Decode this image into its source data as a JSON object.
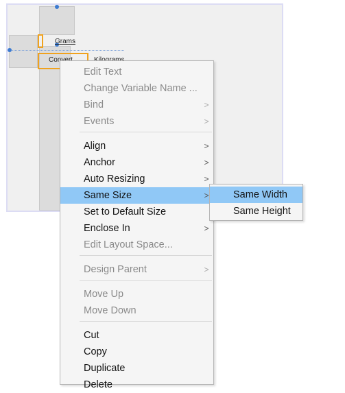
{
  "canvas": {
    "components": [
      {
        "name": "grams-label",
        "text": "Grams"
      },
      {
        "name": "convert-button",
        "text": "Convert"
      },
      {
        "name": "kilograms-label",
        "text": "Kilograms"
      }
    ]
  },
  "context_menu": {
    "items": [
      {
        "label": "Edit Text",
        "enabled": false,
        "submenu": false
      },
      {
        "label": "Change Variable Name ...",
        "enabled": false,
        "submenu": false
      },
      {
        "label": "Bind",
        "enabled": false,
        "submenu": true
      },
      {
        "label": "Events",
        "enabled": false,
        "submenu": true
      },
      {
        "label": "Align",
        "enabled": true,
        "submenu": true
      },
      {
        "label": "Anchor",
        "enabled": true,
        "submenu": true
      },
      {
        "label": "Auto Resizing",
        "enabled": true,
        "submenu": true
      },
      {
        "label": "Same Size",
        "enabled": true,
        "submenu": true,
        "highlighted": true
      },
      {
        "label": "Set to Default Size",
        "enabled": true,
        "submenu": false
      },
      {
        "label": "Enclose In",
        "enabled": true,
        "submenu": true
      },
      {
        "label": "Edit Layout Space...",
        "enabled": false,
        "submenu": false
      },
      {
        "label": "Design Parent",
        "enabled": false,
        "submenu": true
      },
      {
        "label": "Move Up",
        "enabled": false,
        "submenu": false
      },
      {
        "label": "Move Down",
        "enabled": false,
        "submenu": false
      },
      {
        "label": "Cut",
        "enabled": true,
        "submenu": false
      },
      {
        "label": "Copy",
        "enabled": true,
        "submenu": false
      },
      {
        "label": "Duplicate",
        "enabled": true,
        "submenu": false
      },
      {
        "label": "Delete",
        "enabled": true,
        "submenu": false
      }
    ],
    "submenu_chevron": ">"
  },
  "same_size_submenu": {
    "items": [
      {
        "label": "Same Width",
        "highlighted": true
      },
      {
        "label": "Same Height",
        "highlighted": false
      }
    ]
  },
  "colors": {
    "highlight": "#90c8f6",
    "selection_outline": "#f0a21e",
    "handle": "#3c7bd1"
  }
}
